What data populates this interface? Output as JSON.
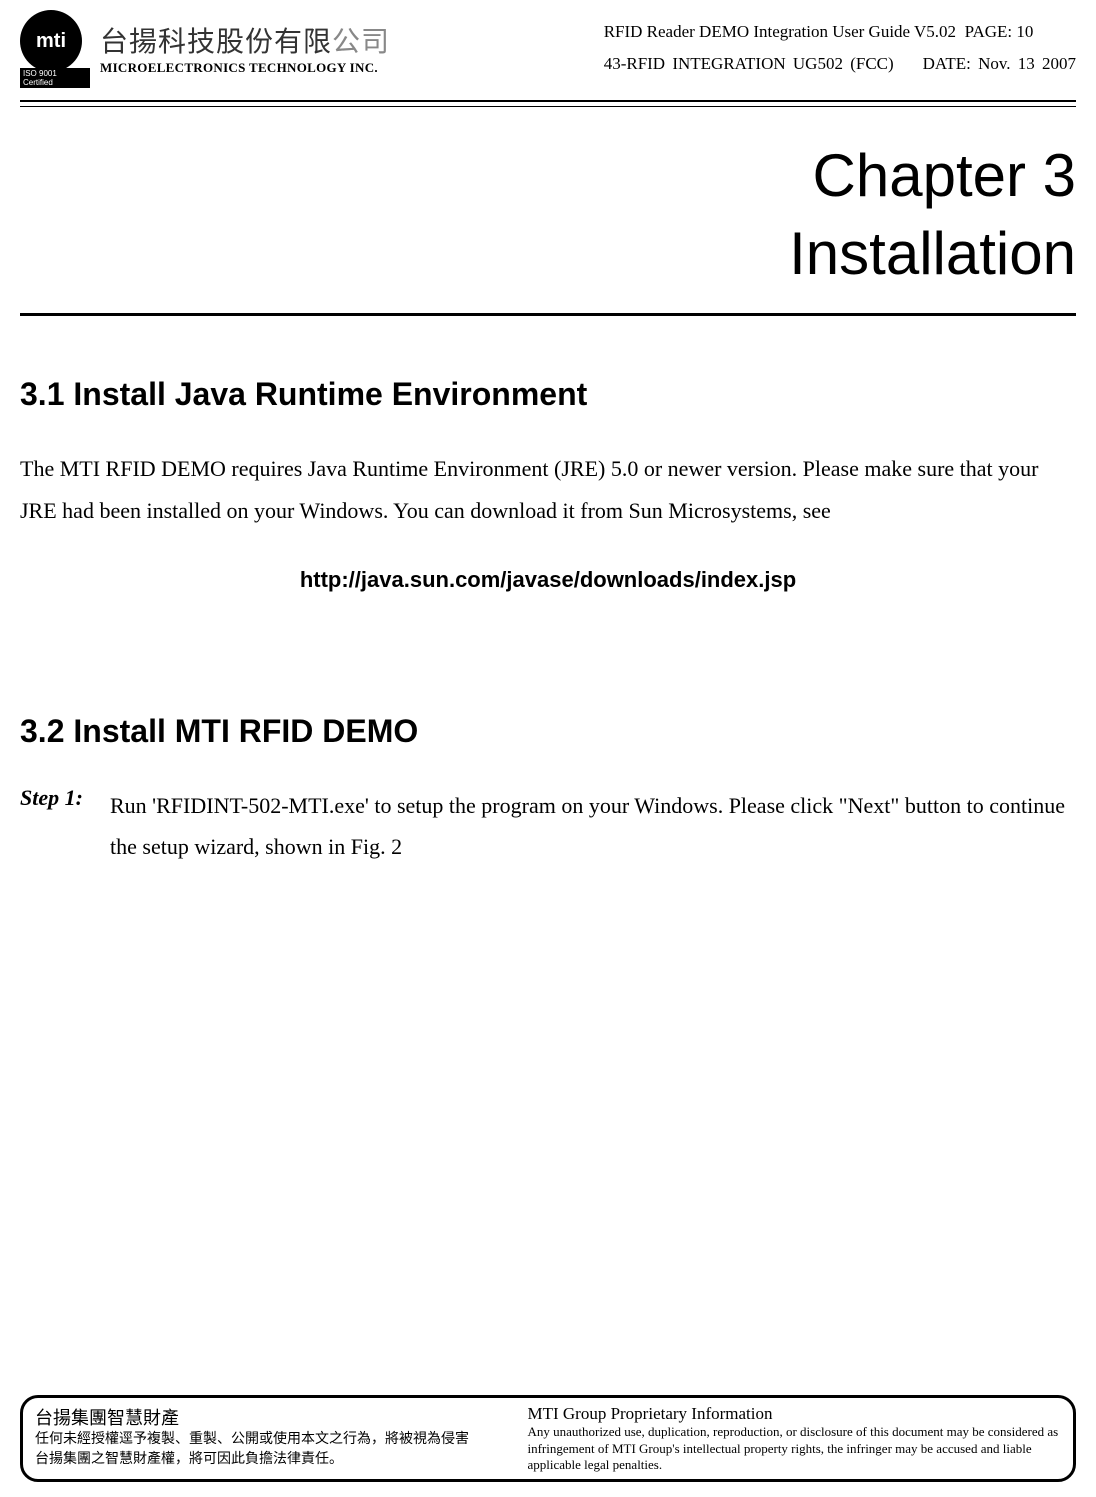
{
  "header": {
    "logo_text": "mti",
    "iso_cert": "ISO 9001 Certified",
    "company_cn_main": "台揚科技股份有限",
    "company_cn_gray": "公司",
    "company_en": "MICROELECTRONICS TECHNOLOGY INC.",
    "doc_title": "RFID Reader DEMO Integration User Guide V5.02",
    "page_label": "PAGE: 10",
    "doc_code": "43-RFID  INTEGRATION  UG502  (FCC)",
    "date_label": "DATE:  Nov.  13  2007"
  },
  "chapter": {
    "line1": "Chapter 3",
    "line2": "Installation"
  },
  "section31": {
    "heading": "3.1  Install Java Runtime Environment",
    "paragraph": "The MTI RFID DEMO requires Java Runtime Environment (JRE) 5.0 or newer version.    Please make sure that your JRE had been installed on your Windows. You can download it from Sun Microsystems, see",
    "url": "http://java.sun.com/javase/downloads/index.jsp"
  },
  "section32": {
    "heading": "3.2  Install MTI RFID DEMO",
    "step1_label": "Step 1:",
    "step1_text": "Run 'RFIDINT-502-MTI.exe' to setup the program on your Windows.    Please click \"Next\" button to continue the setup wizard, shown in Fig. 2"
  },
  "footer": {
    "cn_heading": "台揚集團智慧財產",
    "cn_line1": "任何未經授權逕予複製、重製、公開或使用本文之行為，將被視為侵害",
    "cn_line2": "台揚集團之智慧財產權，將可因此負擔法律責任。",
    "en_heading": "MTI Group Proprietary Information",
    "en_text": "Any unauthorized use, duplication, reproduction, or disclosure of this document may be considered as infringement of MTI Group's intellectual property rights, the infringer may be accused and liable applicable legal penalties."
  }
}
